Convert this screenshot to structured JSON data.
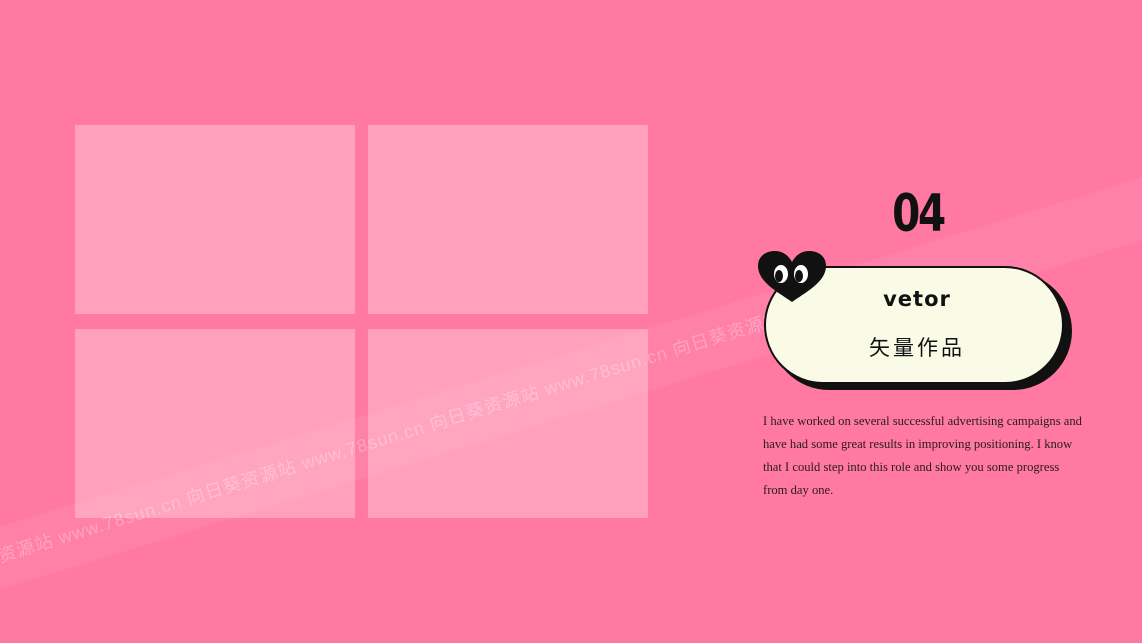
{
  "slide": {
    "number": "04",
    "card": {
      "title": "vetor",
      "subtitle": "矢量作品"
    },
    "description": "I have worked on several successful advertising campaigns and have had some great results in improving positioning. I know that I could step into this role and show you some progress from day one."
  },
  "watermark": {
    "text": "向日葵资源站   www.78sun.cn   向日葵资源站   www.78sun.cn   向日葵资源站   www.78sun.cn   向日葵资源站"
  },
  "colors": {
    "background": "#ff79a3",
    "photo_placeholder": "#ffa0bf",
    "card": "#f9fbe6",
    "ink": "#111111"
  },
  "icons": {
    "heart": "heart-eyes-icon"
  }
}
